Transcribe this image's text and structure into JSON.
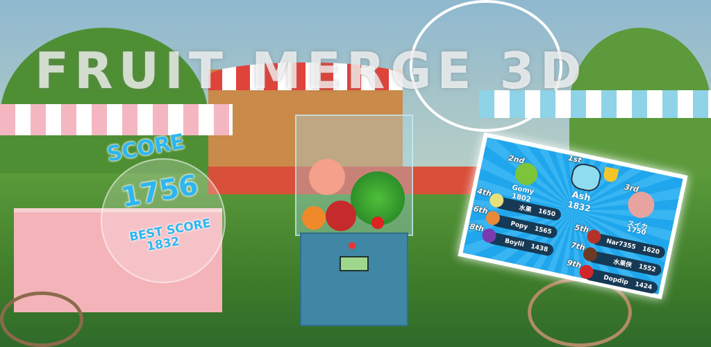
{
  "title": "FRUIT MERGE 3D",
  "score": {
    "label": "SCORE",
    "value": "1756",
    "best_label": "BEST SCORE",
    "best_value": "1832"
  },
  "leaderboard": {
    "podium": [
      {
        "rank": "1st",
        "name": "Ash",
        "score": "1832",
        "avatar": "cat-icon",
        "trophy": "trophy-icon"
      },
      {
        "rank": "2nd",
        "name": "Gomy",
        "score": "1802",
        "avatar": "melon-icon"
      },
      {
        "rank": "3rd",
        "name": "スイカ",
        "score": "1750",
        "avatar": "peach-icon"
      }
    ],
    "rows": [
      {
        "rank": "4th",
        "name": "水果",
        "score": "1650",
        "avatar": "pear-icon",
        "color": "#e8e07a"
      },
      {
        "rank": "5th",
        "name": "Nar7355",
        "score": "1620",
        "avatar": "apple-icon",
        "color": "#b3332a"
      },
      {
        "rank": "6th",
        "name": "Popy",
        "score": "1565",
        "avatar": "orange-icon",
        "color": "#e98a3a"
      },
      {
        "rank": "7th",
        "name": "水果侠",
        "score": "1552",
        "avatar": "coconut-icon",
        "color": "#6b3a24"
      },
      {
        "rank": "8th",
        "name": "Boylil",
        "score": "1438",
        "avatar": "grape-icon",
        "color": "#7a3ab0"
      },
      {
        "rank": "9th",
        "name": "Dopdip",
        "score": "1424",
        "avatar": "strawberry-icon",
        "color": "#d2252a"
      }
    ]
  },
  "colors": {
    "score": "#2eb6f0",
    "board": "#1fa6ec",
    "row": "#163a55"
  }
}
